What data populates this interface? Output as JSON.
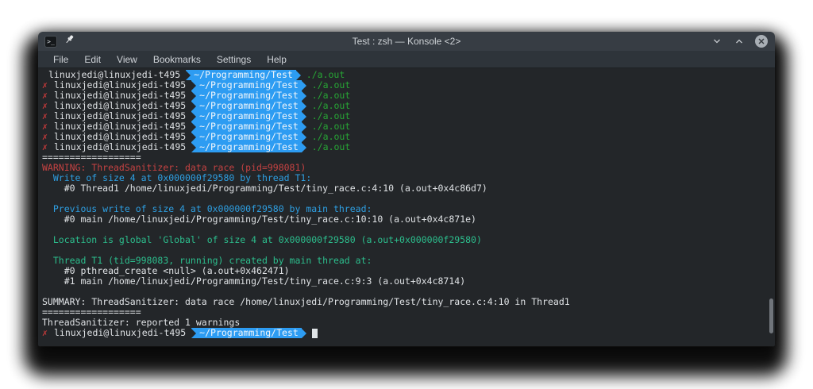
{
  "window": {
    "title": "Test : zsh — Konsole <2>",
    "menu_items": [
      "File",
      "Edit",
      "View",
      "Bookmarks",
      "Settings",
      "Help"
    ]
  },
  "colors": {
    "powerline_blue": "#2d9cf2",
    "command_green": "#27a635",
    "fail_mark_red": "#c23a3a",
    "warning_red": "#c54242",
    "heading_blue": "#2e9fe2",
    "heading_teal": "#2cbe8d",
    "terminal_bg": "#232629",
    "terminal_fg": "#dfe2e5"
  },
  "prompt": {
    "fail_mark": "✗",
    "user_host": "linuxjedi@linuxjedi-t495",
    "path": "~/Programming/Test",
    "command": "./a.out",
    "run_count": 8
  },
  "output": {
    "separator": "==================",
    "warning": "WARNING: ThreadSanitizer: data race (pid=998081)",
    "write_header": "  Write of size 4 at 0x000000f29580 by thread T1:",
    "write_frame0": "    #0 Thread1 /home/linuxjedi/Programming/Test/tiny_race.c:4:10 (a.out+0x4c86d7)",
    "prev_header": "  Previous write of size 4 at 0x000000f29580 by main thread:",
    "prev_frame0": "    #0 main /home/linuxjedi/Programming/Test/tiny_race.c:10:10 (a.out+0x4c871e)",
    "location": "  Location is global 'Global' of size 4 at 0x000000f29580 (a.out+0x000000f29580)",
    "thread_header": "  Thread T1 (tid=998083, running) created by main thread at:",
    "thread_frame0": "    #0 pthread_create <null> (a.out+0x462471)",
    "thread_frame1": "    #1 main /home/linuxjedi/Programming/Test/tiny_race.c:9:3 (a.out+0x4c8714)",
    "summary": "SUMMARY: ThreadSanitizer: data race /home/linuxjedi/Programming/Test/tiny_race.c:4:10 in Thread1",
    "reported": "ThreadSanitizer: reported 1 warnings"
  }
}
